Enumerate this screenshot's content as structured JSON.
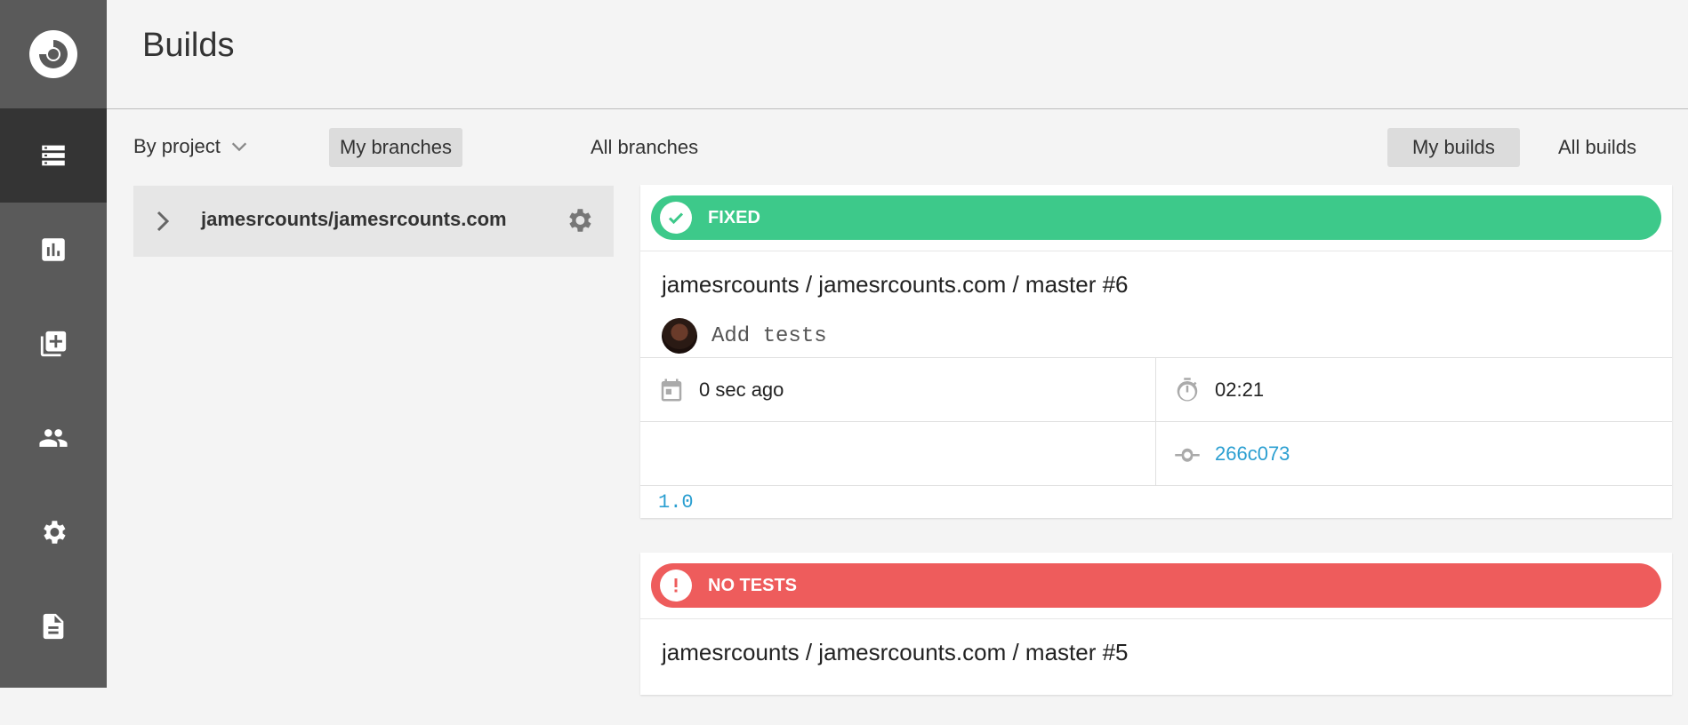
{
  "header": {
    "title": "Builds"
  },
  "sidebar": {
    "items": [
      {
        "name": "builds",
        "icon": "list-icon",
        "active": true
      },
      {
        "name": "insights",
        "icon": "bar-chart-icon",
        "active": false
      },
      {
        "name": "add-projects",
        "icon": "add-project-icon",
        "active": false
      },
      {
        "name": "team",
        "icon": "people-icon",
        "active": false
      },
      {
        "name": "settings",
        "icon": "gear-icon",
        "active": false
      },
      {
        "name": "docs",
        "icon": "document-icon",
        "active": false
      }
    ]
  },
  "filters": {
    "by_project": "By project",
    "branch_tabs": [
      "My branches",
      "All branches"
    ],
    "build_tabs": [
      "My builds",
      "All builds"
    ]
  },
  "projects": [
    {
      "name": "jamesrcounts/jamesrcounts.com"
    }
  ],
  "builds": [
    {
      "status": "FIXED",
      "status_color": "#3dc98a",
      "title": "jamesrcounts / jamesrcounts.com / master #6",
      "commit_message": "Add tests",
      "time_ago": "0 sec ago",
      "duration": "02:21",
      "commit_hash": "266c073",
      "version": "1.0"
    },
    {
      "status": "NO TESTS",
      "status_color": "#ee5c5c",
      "title": "jamesrcounts / jamesrcounts.com / master #5"
    }
  ],
  "colors": {
    "sidebar": "#5a5a5a",
    "sidebar_active": "#343434",
    "link": "#2b9fd1"
  }
}
